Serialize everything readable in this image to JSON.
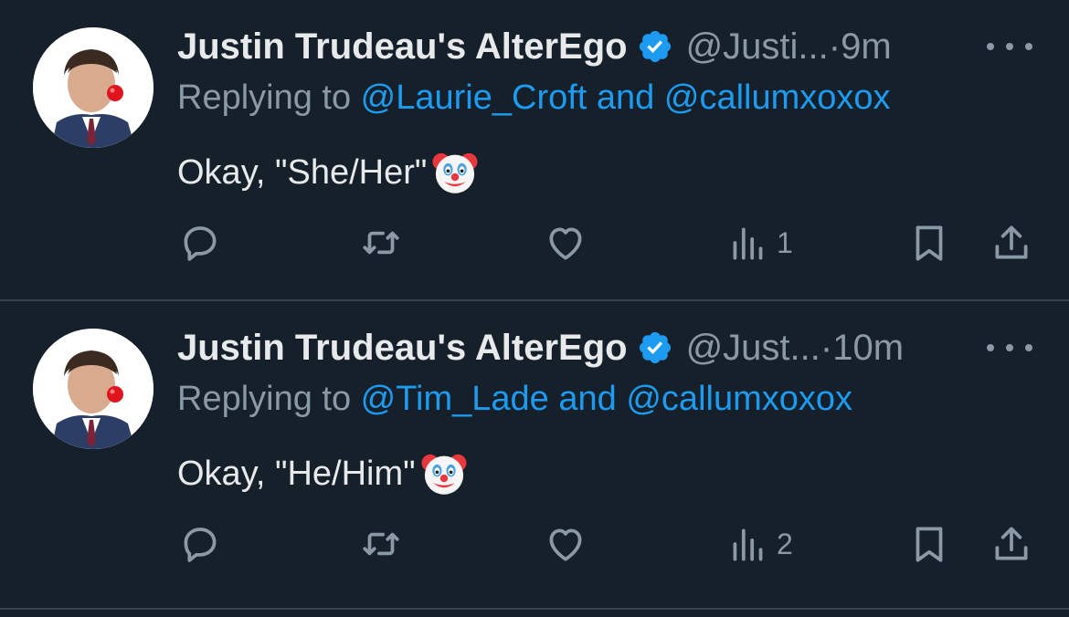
{
  "tweets": [
    {
      "name": "Justin Trudeau's AlterEgo",
      "handle": "@Justi...",
      "time": "·9m",
      "replying_prefix": "Replying to ",
      "reply_user1": "@Laurie_Croft",
      "reply_and": " and ",
      "reply_user2": "@callumxoxox",
      "text": "Okay, \"She/Her\"",
      "emoji": "clown-face",
      "views": "1"
    },
    {
      "name": "Justin Trudeau's AlterEgo",
      "handle": "@Just...",
      "time": "·10m",
      "replying_prefix": "Replying to ",
      "reply_user1": "@Tim_Lade",
      "reply_and": " and ",
      "reply_user2": "@callumxoxox",
      "text": "Okay, \"He/Him\"",
      "emoji": "clown-face",
      "views": "2"
    }
  ],
  "colors": {
    "background": "#15202b",
    "text": "#e7e9ea",
    "secondary": "#8b98a5",
    "link": "#1d9bf0",
    "divider": "#38444d"
  },
  "icons": {
    "reply": "speech-bubble-icon",
    "retweet": "retweet-arrows-icon",
    "like": "heart-icon",
    "views": "bar-chart-icon",
    "bookmark": "bookmark-icon",
    "share": "share-upload-icon",
    "more": "ellipsis-icon",
    "verified": "verified-badge-icon"
  }
}
